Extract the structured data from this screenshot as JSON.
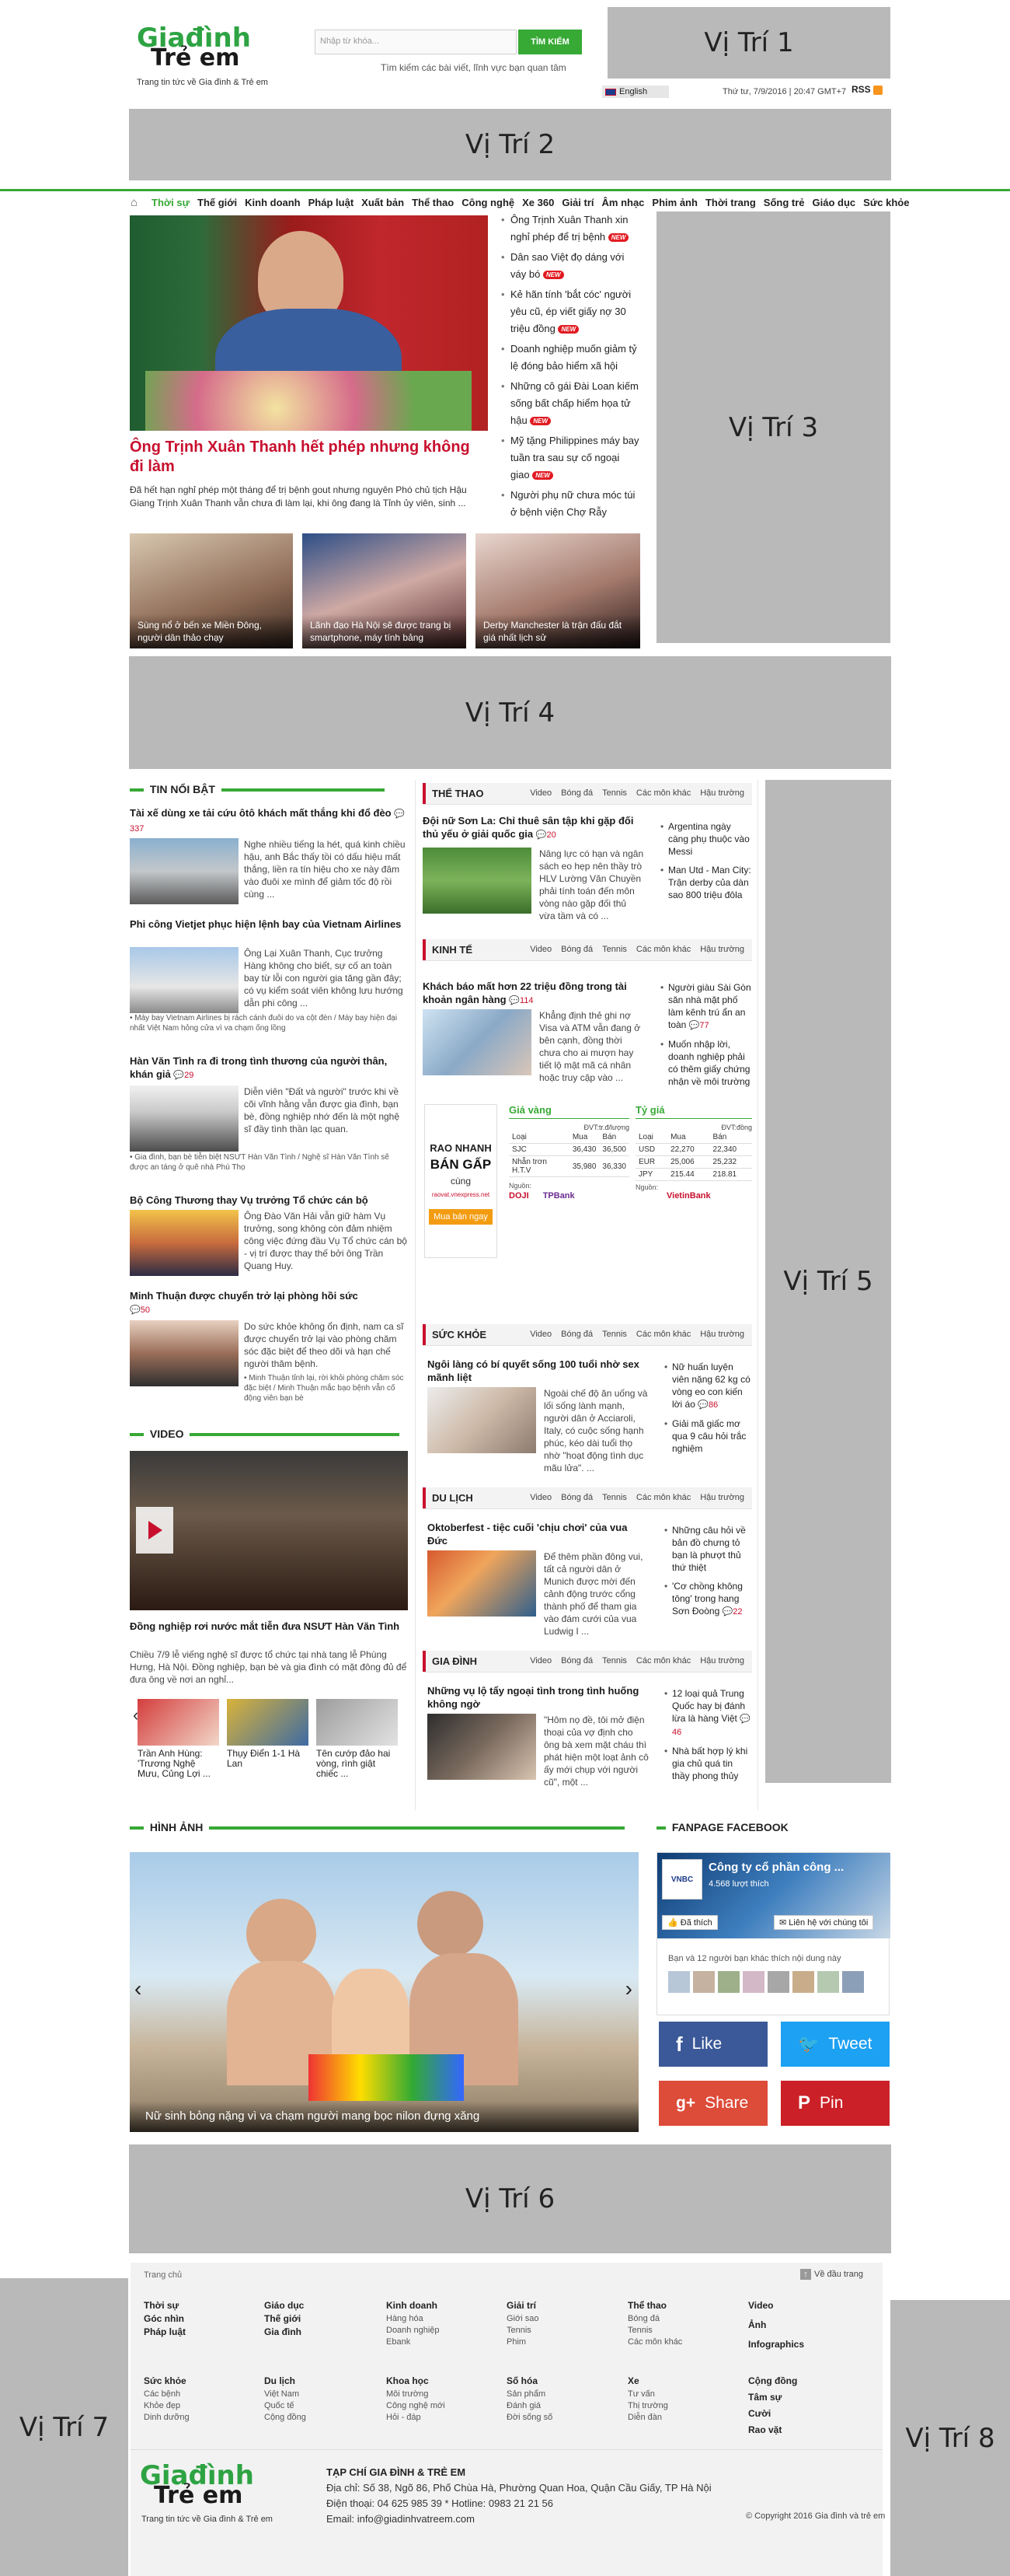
{
  "slots": {
    "s1": "Vị Trí 1",
    "s2": "Vị Trí 2",
    "s3": "Vị Trí 3",
    "s4": "Vị Trí 4",
    "s5": "Vị Trí 5",
    "s6": "Vị Trí 6",
    "s7": "Vị Trí 7",
    "s8": "Vị Trí 8"
  },
  "header": {
    "logo_line1": "Giađình",
    "logo_line2": "Trẻ em",
    "tagline": "Trang tin tức về Gia đình & Trẻ em",
    "search_placeholder": "Nhập từ khóa...",
    "search_button": "TÌM KIẾM",
    "search_hint": "Tìm kiếm các bài viết, lĩnh vực bạn quan tâm",
    "language": "English",
    "datetime": "Thứ tư, 7/9/2016 | 20:47 GMT+7",
    "rss": "RSS"
  },
  "nav": {
    "items": [
      "Thời sự",
      "Thế giới",
      "Kinh doanh",
      "Pháp luật",
      "Xuất bản",
      "Thể thao",
      "Công nghệ",
      "Xe 360",
      "Giải trí",
      "Âm nhạc",
      "Phim ảnh",
      "Thời trang",
      "Sống trẻ",
      "Giáo dục",
      "Sức khỏe"
    ]
  },
  "headline": {
    "title": "Ông Trịnh Xuân Thanh hết phép nhưng không đi làm",
    "summary": "Đã hết hạn nghỉ phép một tháng để trị bệnh gout nhưng nguyên Phó chủ tịch Hậu Giang Trịnh Xuân Thanh vẫn chưa đi làm lại, khi ông đang là Tỉnh ủy viên, sinh ...",
    "side_news": [
      "Ông Trịnh Xuân Thanh xin nghỉ phép để trị bệnh",
      "Dân sao Việt đọ dáng với váy bó",
      "Kẻ hãn tính 'bắt cóc' người yêu cũ, ép viết giấy nợ 30 triệu đồng",
      "Doanh nghiệp muốn giảm tỷ lệ đóng bảo hiểm xã hội",
      "Những cô gái Đài Loan kiếm sống bất chấp hiểm họa tử hậu",
      "Mỹ tặng Philippines máy bay tuần tra sau sự cố ngoại giao",
      "Người phụ nữ chưa móc túi ở bệnh viện Chợ Rẫy"
    ],
    "new_label": "NEW",
    "thumbs": [
      "Sùng nổ ở bến xe Miền Đông, người dân thảo chạy",
      "Lãnh đạo Hà Nội sẽ được trang bị smartphone, máy tính bảng",
      "Derby Manchester là trận đấu đắt giá nhất lịch sử"
    ]
  },
  "tin_noi_bat": {
    "heading": "TIN NỔI BẬT",
    "items": [
      {
        "title": "Tài xế dùng xe tải cứu ôtô khách mất thắng khi đổ đèo",
        "count": "337",
        "summary": "Nghe nhiều tiếng la hét, quá kinh chiều hậu, anh Bắc thấy tồi có dấu hiệu mất thắng, liền ra tín hiệu cho xe này đâm vào đuôi xe mình để giảm tốc độ rồi cùng ...",
        "meta": ""
      },
      {
        "title": "Phi công Vietjet phục hiện lệnh bay của Vietnam Airlines",
        "count": "",
        "summary": "Ông Lại Xuân Thanh, Cục trưởng Hàng không cho biết, sự cố an toàn bay từ lỗi con người gia tăng gần đây; có vụ kiểm soát viên không lưu hướng dẫn phi công ...",
        "meta": "• Máy bay Vietnam Airlines bị rách cánh đuôi do va cột đèn / Máy bay hiện đại nhất Việt Nam hỏng cửa vì va chạm ống lồng"
      },
      {
        "title": "Hàn Văn Tình ra đi trong tình thương của người thân, khán giả",
        "count": "29",
        "summary": "Diễn viên \"Đất và người\" trước khi về cõi vĩnh hằng vẫn được gia đình, bạn bè, đồng nghiệp nhớ đến là một nghệ sĩ đầy tình thần lạc quan.",
        "meta": "• Gia đình, bạn bè tiễn biệt NSƯT Hàn Văn Tình / Nghệ sĩ Hàn Văn Tình sẽ được an táng ở quê nhà Phú Thọ"
      },
      {
        "title": "Bộ Công Thương thay Vụ trưởng Tổ chức cán bộ",
        "count": "",
        "summary": "Ông Đào Văn Hải vẫn giữ hàm Vụ trưởng, song không còn đảm nhiệm công việc đứng đầu Vụ Tổ chức cán bộ - vị trí được thay thế bởi ông Trần Quang Huy.",
        "meta": ""
      },
      {
        "title": "Minh Thuận được chuyển trở lại phòng hồi sức",
        "count": "50",
        "summary": "Do sức khỏe không ổn định, nam ca sĩ được chuyển trở lại vào phòng chăm sóc đặc biệt để theo dõi và hạn chế người thăm bệnh.",
        "meta": "• Minh Thuận tỉnh lại, rời khỏi phòng chăm sóc đặc biệt / Minh Thuận mắc bạo bệnh vẫn cố động viên bạn bè"
      }
    ]
  },
  "video": {
    "heading": "VIDEO",
    "title": "Đồng nghiệp rơi nước mắt tiễn đưa NSƯT Hàn Văn Tình",
    "summary": "Chiều 7/9 lễ viếng nghệ sĩ được tổ chức tại nhà tang lễ Phùng Hưng, Hà Nội. Đồng nghiệp, bạn bè và gia đình có mặt đông đủ để đưa ông về nơi an nghỉ...",
    "thumbs": [
      "Trần Anh Hùng: 'Trương Nghệ Mưu, Củng Lợi ...",
      "Thụy Điển 1-1 Hà Lan",
      "Tên cướp đảo hai vòng, rình giật chiếc ..."
    ]
  },
  "categories": [
    {
      "name": "THỂ THAO",
      "tabs": [
        "Video",
        "Bóng đá",
        "Tennis",
        "Các môn khác",
        "Hậu trường"
      ],
      "title": "Đội nữ Sơn La: Chỉ thuê sân tập khi gặp đối thủ yếu ở giải quốc gia",
      "count": "20",
      "summary": "Nâng lực có hạn và ngân sách eo hẹp nên thầy trò HLV Lường Văn Chuyền phải tính toán đến môn vòng nào gặp đối thủ vừa tầm và có ...",
      "bullets": [
        {
          "text": "Argentina ngày càng phụ thuộc vào Messi",
          "count": ""
        },
        {
          "text": "Man Utd - Man City: Trận derby của dàn sao 800 triệu đôla",
          "count": ""
        }
      ]
    },
    {
      "name": "KINH TẾ",
      "tabs": [
        "Video",
        "Bóng đá",
        "Tennis",
        "Các môn khác",
        "Hậu trường"
      ],
      "title": "Khách báo mất hơn 22 triệu đồng trong tài khoản ngân hàng",
      "count": "114",
      "summary": "Khẳng định thẻ ghi nợ Visa và ATM vẫn đang ở bên cạnh, đồng thời chưa cho ai mượn hay tiết lộ mật mã cá nhân hoặc truy cập vào ...",
      "bullets": [
        {
          "text": "Người giàu Sài Gòn săn nhà mặt phố làm kênh trú ẩn an toàn",
          "count": "77"
        },
        {
          "text": "Muốn nhập lời, doanh nghiệp phải có thêm giấy chứng nhận về môi trường",
          "count": ""
        }
      ]
    },
    {
      "name": "SỨC KHỎE",
      "tabs": [
        "Video",
        "Bóng đá",
        "Tennis",
        "Các môn khác",
        "Hậu trường"
      ],
      "title": "Ngôi làng có bí quyết sống 100 tuổi nhờ sex mãnh liệt",
      "count": "",
      "summary": "Ngoài chế độ ăn uống và lối sống lành mạnh, người dân ở Acciaroli, Italy, có cuộc sống hạnh phúc, kéo dài tuổi thọ nhờ \"hoạt động tình dục mãu lửa\". ...",
      "bullets": [
        {
          "text": "Nữ huấn luyện viên nặng 62 kg có vòng eo con kiến lời áo",
          "count": "86"
        },
        {
          "text": "Giải mã giấc mơ qua 9 câu hỏi trắc nghiệm",
          "count": ""
        }
      ]
    },
    {
      "name": "DU LỊCH",
      "tabs": [
        "Video",
        "Bóng đá",
        "Tennis",
        "Các môn khác",
        "Hậu trường"
      ],
      "title": "Oktoberfest - tiệc cuối 'chịu chơi' của vua Đức",
      "count": "",
      "summary": "Để thêm phần đông vui, tất cả người dân ở Munich được mời đến cảnh động trước cổng thành phố để tham gia vào đám cưới của vua Ludwig I ...",
      "bullets": [
        {
          "text": "Những câu hỏi về bản đồ chưng tỏ bạn là phượt thủ thứ thiệt",
          "count": ""
        },
        {
          "text": "'Cơ chồng không tông' trong hang Sơn Đoòng",
          "count": "22"
        }
      ]
    },
    {
      "name": "GIA ĐÌNH",
      "tabs": [
        "Video",
        "Bóng đá",
        "Tennis",
        "Các môn khác",
        "Hậu trường"
      ],
      "title": "Những vụ lộ tẩy ngoại tình trong tình huống không ngờ",
      "count": "",
      "summary": "\"Hôm nọ đề, tôi mở điện thoại của vợ định cho ông bà xem mặt cháu thì phát hiện một loạt ảnh cô ấy mới chụp với người cũ\", một ...",
      "bullets": [
        {
          "text": "12 loại quả Trung Quốc hay bị đánh lừa là hàng Việt",
          "count": "46"
        },
        {
          "text": "Nhà bất hợp lý khi gia chủ quá tin thầy phong thủy",
          "count": ""
        }
      ]
    }
  ],
  "raonhanh": {
    "line1": "RAO NHANH",
    "line2": "BÁN GẤP",
    "line3": "cùng",
    "line4": "raovat.vnexpress.net",
    "button": "Mua bán ngay"
  },
  "gold": {
    "title": "Giá vàng",
    "unit": "ĐVT:tr.đ/lượng",
    "headers": [
      "Loại",
      "Mua",
      "Bán"
    ],
    "rows": [
      [
        "SJC",
        "36,430",
        "36,500"
      ],
      [
        "Nhẫn trơn H.T.V",
        "35,980",
        "36,330"
      ]
    ],
    "source_label": "Nguồn:",
    "sources": [
      "DOJI",
      "TPBank"
    ]
  },
  "forex": {
    "title": "Tỷ giá",
    "unit": "ĐVT:đồng",
    "headers": [
      "Loại",
      "Mua",
      "Bán"
    ],
    "rows": [
      [
        "USD",
        "22,270",
        "22,340"
      ],
      [
        "EUR",
        "25,006",
        "25,232"
      ],
      [
        "JPY",
        "215.44",
        "218.81"
      ]
    ],
    "source_label": "Nguồn:",
    "source": "VietinBank"
  },
  "hinh_anh": {
    "heading": "HÌNH ẢNH",
    "caption": "Nữ sinh bỏng nặng vì va chạm người mang bọc nilon đựng xăng"
  },
  "fanpage": {
    "heading": "FANPAGE FACEBOOK",
    "company": "Công ty cổ phần công ...",
    "likes": "4.568 lượt thích",
    "like_btn": "Đã thích",
    "contact": "Liên hệ với chúng tôi",
    "friends": "Bạn và 12 người bạn khác thích nội dung này",
    "social": [
      "Like",
      "Tweet",
      "Share",
      "Pin"
    ]
  },
  "footer": {
    "home": "Trang chủ",
    "top": "Về đầu trang",
    "cols": [
      {
        "items": [
          "Thời sự",
          "Góc nhìn",
          "Pháp luật"
        ]
      },
      {
        "items": [
          "Giáo dục",
          "Thế giới",
          "Gia đình"
        ]
      },
      {
        "items": [
          "Kinh doanh"
        ],
        "subs": [
          "Hàng hóa",
          "Doanh nghiệp",
          "Ebank"
        ]
      },
      {
        "items": [
          "Giải trí"
        ],
        "subs": [
          "Giới sao",
          "Tennis",
          "Phim"
        ]
      },
      {
        "items": [
          "Thể thao"
        ],
        "subs": [
          "Bóng đá",
          "Tennis",
          "Các môn khác"
        ]
      },
      {
        "items": [
          "Video",
          "Ảnh",
          "Infographics"
        ]
      }
    ],
    "cols2": [
      {
        "items": [
          "Sức khỏe"
        ],
        "subs": [
          "Các bệnh",
          "Khỏe đẹp",
          "Dinh dưỡng"
        ]
      },
      {
        "items": [
          "Du lịch"
        ],
        "subs": [
          "Việt Nam",
          "Quốc tế",
          "Cộng đồng"
        ]
      },
      {
        "items": [
          "Khoa học"
        ],
        "subs": [
          "Môi trường",
          "Công nghệ mới",
          "Hỏi - đáp"
        ]
      },
      {
        "items": [
          "Số hóa"
        ],
        "subs": [
          "Sản phẩm",
          "Đánh giá",
          "Đời sống số"
        ]
      },
      {
        "items": [
          "Xe"
        ],
        "subs": [
          "Tư vấn",
          "Thị trường",
          "Diễn đàn"
        ]
      },
      {
        "items": [
          "Cộng đồng",
          "Tâm sự",
          "Cười",
          "Rao vặt"
        ]
      }
    ],
    "company": "TẠP CHÍ GIA ĐÌNH & TRẺ EM",
    "address": "Địa chỉ: Số 38, Ngõ 86, Phố Chùa Hà, Phường Quan Hoa, Quận Cầu Giấy, TP Hà Nội",
    "phone": "Điện thoại: 04 625 985 39 * Hotline: 0983 21 21 56",
    "email": "Email: info@giadinhvatreem.com",
    "copyright": "© Copyright 2016 Gia đình và trẻ em"
  }
}
